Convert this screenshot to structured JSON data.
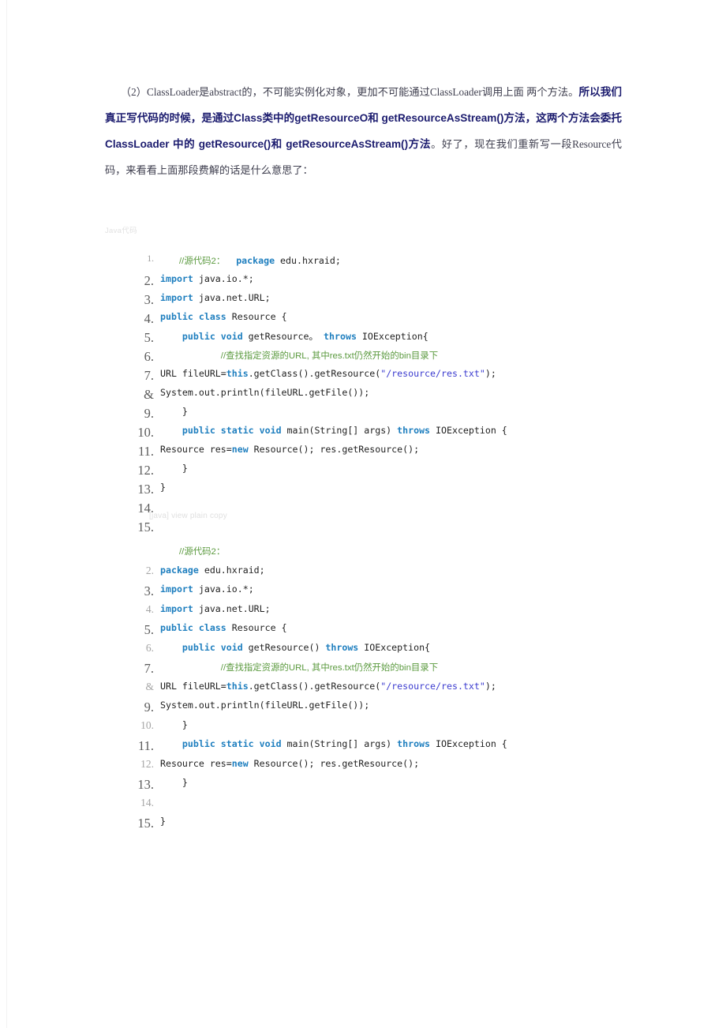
{
  "document": {
    "paragraph": [
      {
        "style": "plain",
        "text": "　　（2）ClassLoader是abstract的，不可能实例化对象，更加不可能通过ClassLoader调用上面 两个方法。"
      },
      {
        "style": "emph",
        "text": "所以我们真正写代码的时候，是通过Class类中的getResourceO和 getResourceAsStream()方法，这两个方法会委托 ClassLoader 中的 getResource()和 getResourceAsStream()方法"
      },
      {
        "style": "plain",
        "text": "。好了，现在我们重新写一段Resource代码，来看看上面那段费解的话是什么意思了："
      }
    ]
  },
  "code_block_1": {
    "label": "Java代码",
    "toolbar": "[java] view plain copy",
    "rows": [
      {
        "num": "1.",
        "num_size": "tiny",
        "indent": 24,
        "tokens": [
          {
            "t": "cmt-cn",
            "v": "//源代码2："
          },
          {
            "t": "pl",
            "v": "  "
          },
          {
            "t": "kw",
            "v": "package"
          },
          {
            "t": "pl",
            "v": " edu.hxraid;"
          }
        ]
      },
      {
        "num": "2.",
        "num_size": "big",
        "indent": 0,
        "tokens": [
          {
            "t": "kw",
            "v": "import"
          },
          {
            "t": "pl",
            "v": " java.io.*;"
          }
        ]
      },
      {
        "num": "3.",
        "num_size": "big",
        "indent": 0,
        "tokens": [
          {
            "t": "kw",
            "v": "import"
          },
          {
            "t": "pl",
            "v": " java.net.URL;"
          }
        ]
      },
      {
        "num": "4.",
        "num_size": "big",
        "indent": 0,
        "tokens": [
          {
            "t": "kw",
            "v": "public class"
          },
          {
            "t": "pl",
            "v": " Resource {"
          }
        ]
      },
      {
        "num": "5.",
        "num_size": "big",
        "indent": 0,
        "tokens": [
          {
            "t": "pl",
            "v": "    "
          },
          {
            "t": "kw",
            "v": "public void"
          },
          {
            "t": "pl",
            "v": " getResource。 "
          },
          {
            "t": "kw",
            "v": "throws"
          },
          {
            "t": "pl",
            "v": " IOException{"
          }
        ]
      },
      {
        "num": "6.",
        "num_size": "big",
        "indent": 0,
        "tokens": [
          {
            "t": "pl",
            "v": "           "
          },
          {
            "t": "cmt-cn",
            "v": "//查找指定资源的URL, 其中res.txt仍然开始的bin目录下"
          }
        ]
      },
      {
        "num": "7.",
        "num_size": "big",
        "indent": 0,
        "tokens": [
          {
            "t": "pl",
            "v": "URL fileURL="
          },
          {
            "t": "kw",
            "v": "this"
          },
          {
            "t": "pl",
            "v": ".getClass().getResource("
          },
          {
            "t": "str",
            "v": "\"/resource/res.txt\""
          },
          {
            "t": "pl",
            "v": ");"
          }
        ]
      },
      {
        "num": "&",
        "num_size": "big",
        "indent": 0,
        "tokens": [
          {
            "t": "pl",
            "v": "System.out.println(fileURL.getFile());"
          }
        ]
      },
      {
        "num": "9.",
        "num_size": "big",
        "indent": 0,
        "tokens": [
          {
            "t": "pl",
            "v": "    }"
          }
        ]
      },
      {
        "num": "10.",
        "num_size": "big",
        "indent": 0,
        "tokens": [
          {
            "t": "pl",
            "v": "    "
          },
          {
            "t": "kw",
            "v": "public static void"
          },
          {
            "t": "pl",
            "v": " main(String[] args) "
          },
          {
            "t": "kw",
            "v": "throws"
          },
          {
            "t": "pl",
            "v": " IOException {"
          }
        ]
      },
      {
        "num": "11.",
        "num_size": "big",
        "indent": 0,
        "tokens": [
          {
            "t": "pl",
            "v": "Resource res="
          },
          {
            "t": "kw",
            "v": "new"
          },
          {
            "t": "pl",
            "v": " Resource(); res.getResource();"
          }
        ]
      },
      {
        "num": "12.",
        "num_size": "big",
        "indent": 0,
        "tokens": [
          {
            "t": "pl",
            "v": "    }"
          }
        ]
      },
      {
        "num": "13.",
        "num_size": "big",
        "indent": 0,
        "tokens": [
          {
            "t": "pl",
            "v": "}"
          }
        ]
      },
      {
        "num": "14.",
        "num_size": "big",
        "indent": 0,
        "tokens": []
      },
      {
        "num": "15.",
        "num_size": "big",
        "indent": 0,
        "tokens": []
      }
    ]
  },
  "code_block_2": {
    "rows": [
      {
        "num": "",
        "num_size": "big",
        "indent": 24,
        "tokens": [
          {
            "t": "cmt-cn",
            "v": "//源代码2："
          }
        ]
      },
      {
        "num": "2.",
        "num_size": "sml",
        "indent": 0,
        "tokens": [
          {
            "t": "kw",
            "v": "package"
          },
          {
            "t": "pl",
            "v": " edu.hxraid;"
          }
        ]
      },
      {
        "num": "3.",
        "num_size": "big",
        "indent": 0,
        "tokens": [
          {
            "t": "kw",
            "v": "import"
          },
          {
            "t": "pl",
            "v": " java.io.*;"
          }
        ]
      },
      {
        "num": "4.",
        "num_size": "sml",
        "indent": 0,
        "tokens": [
          {
            "t": "kw",
            "v": "import"
          },
          {
            "t": "pl",
            "v": " java.net.URL;"
          }
        ]
      },
      {
        "num": "5.",
        "num_size": "big",
        "indent": 0,
        "tokens": [
          {
            "t": "kw",
            "v": "public class"
          },
          {
            "t": "pl",
            "v": " Resource {"
          }
        ]
      },
      {
        "num": "6.",
        "num_size": "sml",
        "indent": 0,
        "tokens": [
          {
            "t": "pl",
            "v": "    "
          },
          {
            "t": "kw",
            "v": "public void"
          },
          {
            "t": "pl",
            "v": " getResource() "
          },
          {
            "t": "kw",
            "v": "throws"
          },
          {
            "t": "pl",
            "v": " IOException{"
          }
        ]
      },
      {
        "num": "7.",
        "num_size": "big",
        "indent": 0,
        "tokens": [
          {
            "t": "pl",
            "v": "           "
          },
          {
            "t": "cmt-cn",
            "v": "//查找指定资源的URL, 其中res.txt仍然开始的bin目录下"
          }
        ]
      },
      {
        "num": "&",
        "num_size": "sml",
        "indent": 0,
        "tokens": [
          {
            "t": "pl",
            "v": "URL fileURL="
          },
          {
            "t": "kw",
            "v": "this"
          },
          {
            "t": "pl",
            "v": ".getClass().getResource("
          },
          {
            "t": "str",
            "v": "\"/resource/res.txt\""
          },
          {
            "t": "pl",
            "v": ");"
          }
        ]
      },
      {
        "num": "9.",
        "num_size": "big",
        "indent": 0,
        "tokens": [
          {
            "t": "pl",
            "v": "System.out.println(fileURL.getFile());"
          }
        ]
      },
      {
        "num": "10.",
        "num_size": "sml",
        "indent": 0,
        "tokens": [
          {
            "t": "pl",
            "v": "    }"
          }
        ]
      },
      {
        "num": "11.",
        "num_size": "big",
        "indent": 0,
        "tokens": [
          {
            "t": "pl",
            "v": "    "
          },
          {
            "t": "kw",
            "v": "public static void"
          },
          {
            "t": "pl",
            "v": " main(String[] args) "
          },
          {
            "t": "kw",
            "v": "throws"
          },
          {
            "t": "pl",
            "v": " IOException {"
          }
        ]
      },
      {
        "num": "12.",
        "num_size": "sml",
        "indent": 0,
        "tokens": [
          {
            "t": "pl",
            "v": "Resource res="
          },
          {
            "t": "kw",
            "v": "new"
          },
          {
            "t": "pl",
            "v": " Resource(); res.getResource();"
          }
        ]
      },
      {
        "num": "13.",
        "num_size": "big",
        "indent": 0,
        "tokens": [
          {
            "t": "pl",
            "v": "    }"
          }
        ]
      },
      {
        "num": "14.",
        "num_size": "sml",
        "indent": 0,
        "tokens": []
      },
      {
        "num": "15.",
        "num_size": "big",
        "indent": 0,
        "tokens": [
          {
            "t": "pl",
            "v": "}"
          }
        ]
      }
    ]
  },
  "colors": {
    "keyword": "#1f7fbf",
    "comment": "#5b9a3f",
    "string": "#3b3bcf",
    "emphasis": "#1b1b6e",
    "body_text": "#3f3f4f",
    "gutter": "#8c8c8c"
  }
}
